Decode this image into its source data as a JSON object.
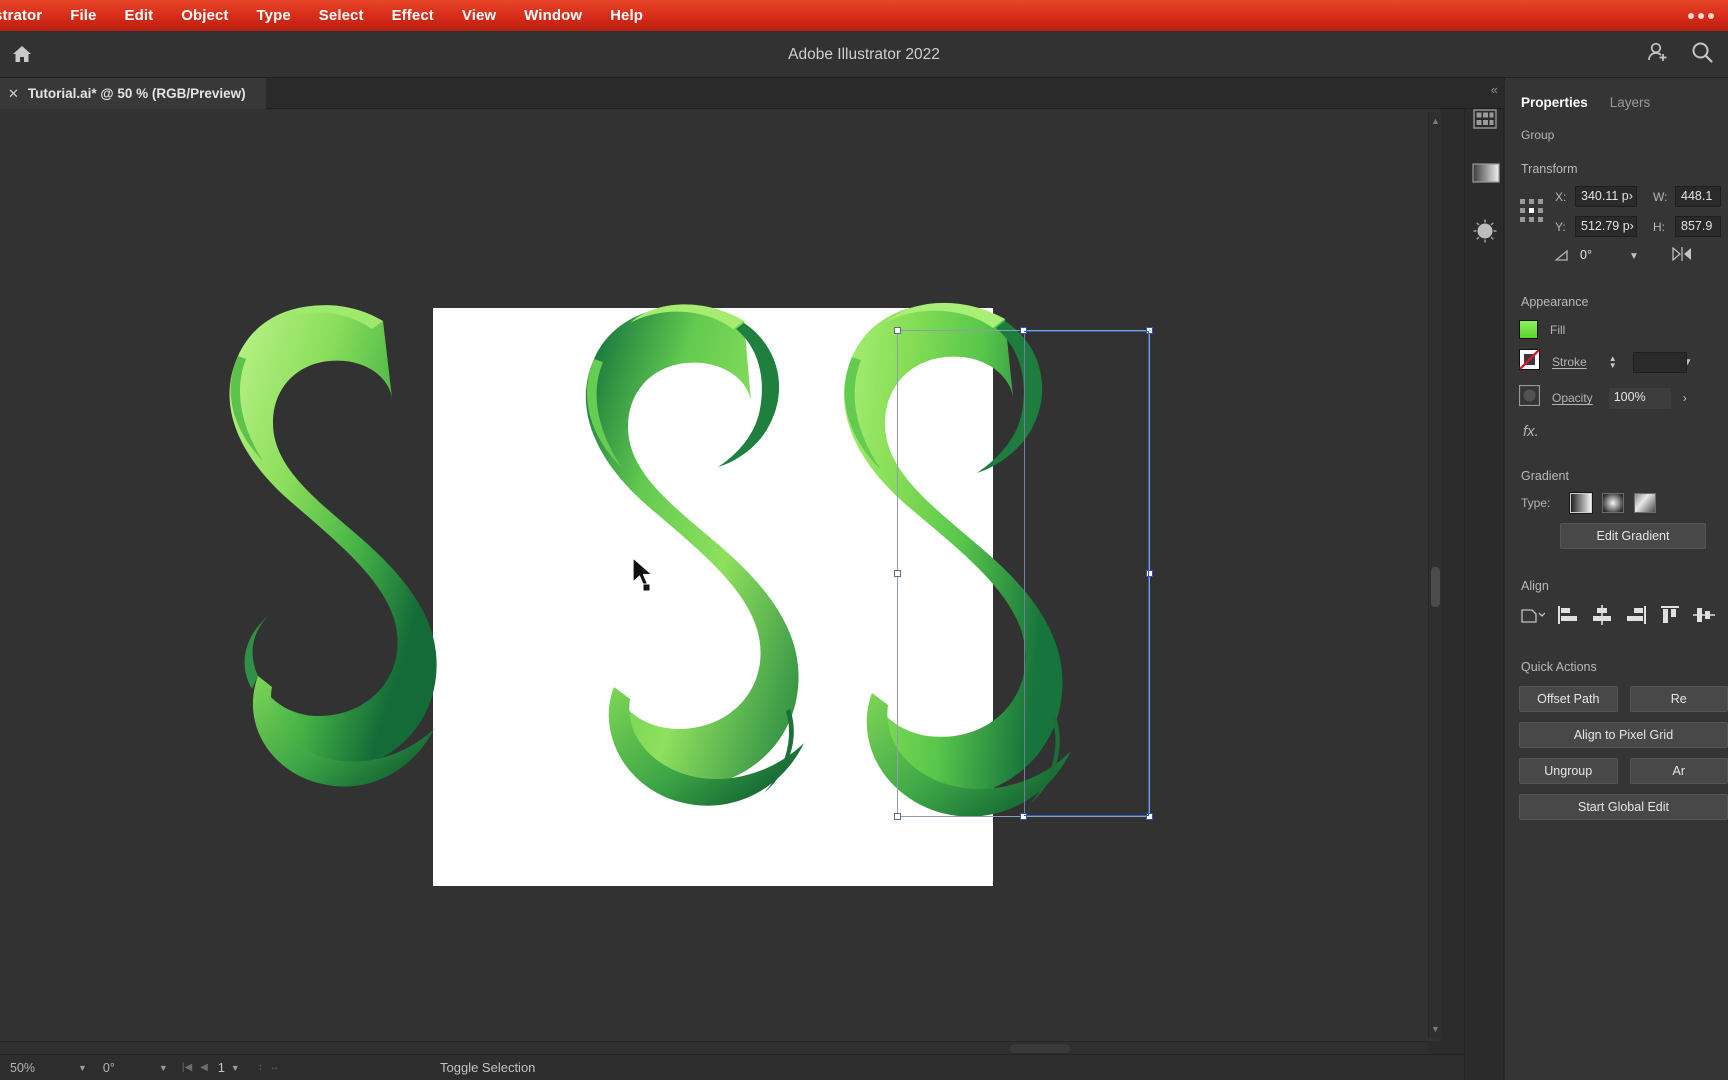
{
  "menubar": {
    "items": [
      {
        "label": "strator",
        "app": true
      },
      {
        "label": "File"
      },
      {
        "label": "Edit"
      },
      {
        "label": "Object"
      },
      {
        "label": "Type"
      },
      {
        "label": "Select"
      },
      {
        "label": "Effect"
      },
      {
        "label": "View"
      },
      {
        "label": "Window"
      },
      {
        "label": "Help"
      }
    ],
    "overflow_icon": "ellipsis-icon",
    "bar_color": "#d62b19"
  },
  "titlebar": {
    "app_title": "Adobe Illustrator 2022",
    "home_icon": "home-icon",
    "share_icon": "add-user-icon",
    "search_icon": "search-icon"
  },
  "document_tab": {
    "close_label": "✕",
    "name": "Tutorial.ai* @ 50 % (RGB/Preview)",
    "collapse_label": "«"
  },
  "canvas": {
    "artwork_description": "Three green gradient letter S shapes; the rightmost is selected",
    "gradient_light": "#8ade5a",
    "gradient_mid": "#56c44a",
    "gradient_dark": "#1c7a3e",
    "artboard_background": "#ffffff",
    "selection_border_color": "#8e9cb5",
    "cursor_icon": "arrow-cursor-icon"
  },
  "panel": {
    "tabs": [
      {
        "label": "Properties",
        "active": true
      },
      {
        "label": "Layers",
        "active": false
      }
    ],
    "object_type": "Group",
    "transform": {
      "title": "Transform",
      "reference_point_icon": "reference-point-grid-icon",
      "x_label": "X:",
      "x_value": "340.11 p›",
      "y_label": "Y:",
      "y_value": "512.79 p›",
      "w_label": "W:",
      "w_value": "448.1",
      "h_label": "H:",
      "h_value": "857.9",
      "angle_label": "∢:",
      "angle_value": "0°",
      "flip_icon": "flip-horizontal-icon",
      "chevron_icon": "chevron-down-icon"
    },
    "appearance": {
      "title": "Appearance",
      "fill_label": "Fill",
      "fill_color": "#6cdc3a",
      "stroke_label": "Stroke",
      "stroke_value": "",
      "opacity_label": "Opacity",
      "opacity_value": "100%",
      "fx_label": "fx.",
      "fill_icon": "fill-swatch-icon",
      "stroke_icon": "stroke-none-icon",
      "opacity_icon": "opacity-swatch-icon",
      "more_icon": "chevron-right-icon"
    },
    "gradient": {
      "title": "Gradient",
      "type_label": "Type:",
      "types": [
        "linear-gradient-icon",
        "radial-gradient-icon",
        "freeform-gradient-icon"
      ],
      "selected_type_index": 0,
      "edit_label": "Edit Gradient"
    },
    "align": {
      "title": "Align",
      "icons": [
        "align-to-selection-icon",
        "align-left-icon",
        "align-horizontal-center-icon",
        "align-right-icon",
        "align-top-icon",
        "align-vertical-center-icon"
      ]
    },
    "quick_actions": {
      "title": "Quick Actions",
      "buttons": [
        {
          "label": "Offset Path"
        },
        {
          "label": "Re"
        },
        {
          "label": "Align to Pixel Grid"
        },
        {
          "label": "Ungroup"
        },
        {
          "label": "Ar"
        },
        {
          "label": "Start Global Edit"
        }
      ]
    },
    "rail_icons": [
      "libraries-icon",
      "gradient-panel-icon",
      "color-wheel-icon"
    ]
  },
  "statusbar": {
    "zoom": "50%",
    "rotation": "0°",
    "artboard_number": "1",
    "artboard_dims": "↕ ↔",
    "tool_status": "Toggle Selection",
    "nav_first_icon": "first-artboard-icon",
    "nav_prev_icon": "prev-artboard-icon",
    "caret_icon": "chevron-down-icon",
    "play_icon": "play-icon",
    "back_icon": "chevron-left-icon"
  }
}
